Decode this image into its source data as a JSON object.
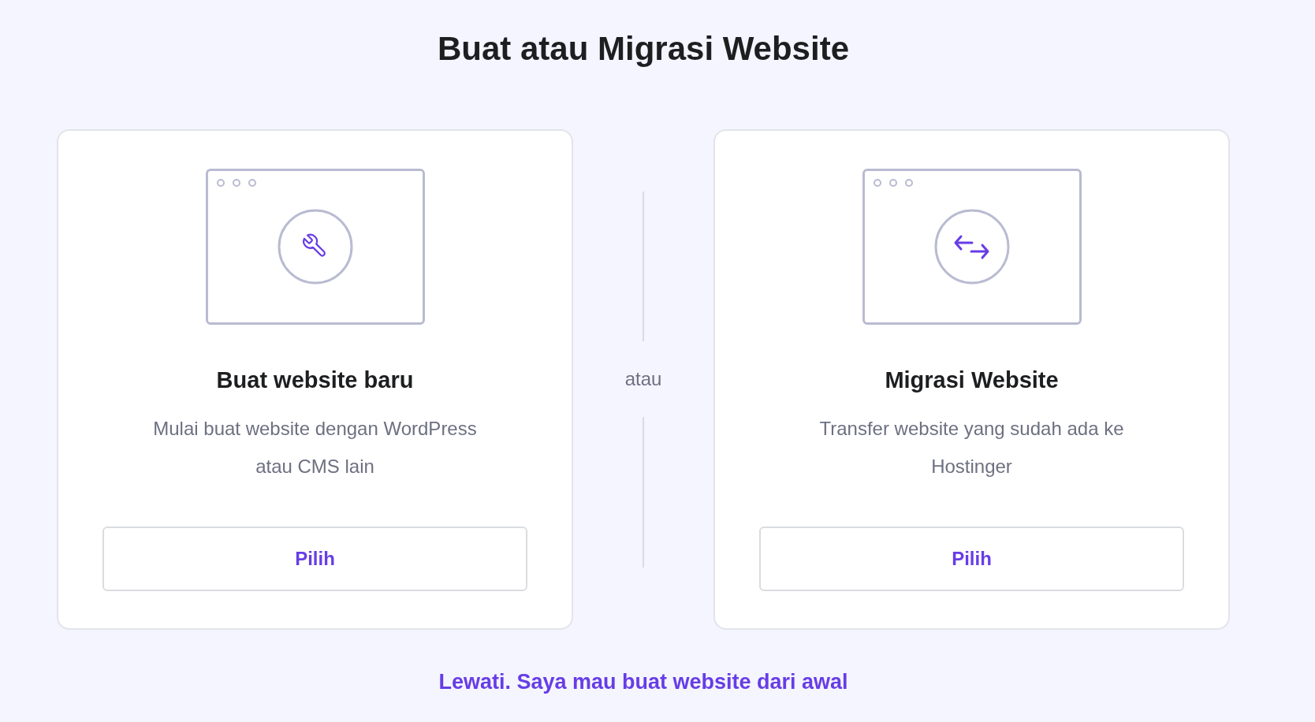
{
  "title": "Buat atau Migrasi Website",
  "options": [
    {
      "kind": "build",
      "title": "Buat website baru",
      "description": "Mulai buat website dengan WordPress atau CMS lain",
      "button": "Pilih"
    },
    {
      "kind": "migrate",
      "title": "Migrasi Website",
      "description": "Transfer website yang sudah ada ke Hostinger",
      "button": "Pilih"
    }
  ],
  "separator": "atau",
  "skip_link": "Lewati. Saya mau buat website dari awal"
}
